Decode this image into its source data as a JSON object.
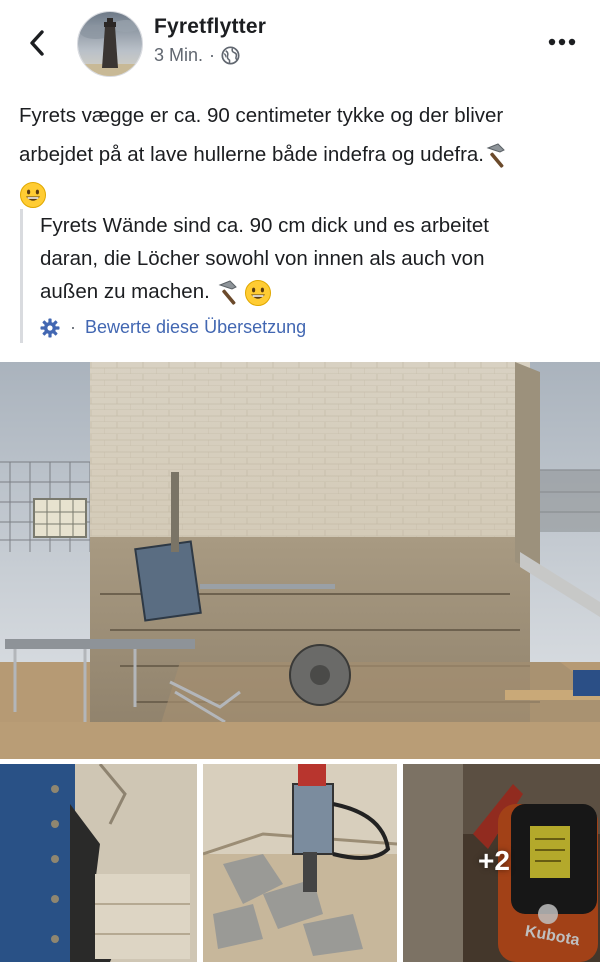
{
  "header": {
    "author_name": "Fyretflytter",
    "time": "3 Min.",
    "meta_separator": "·",
    "audience_icon": "globe-icon",
    "back_icon": "chevron-left-icon",
    "more_icon": "more-dots-icon"
  },
  "post": {
    "line1": "Fyrets vægge er ca. 90 centimeter tykke og der bliver",
    "line2": "arbejdet på at lave hullerne både indefra og udefra.",
    "emojis": [
      "hammer-emoji",
      "grinning-face-emoji"
    ]
  },
  "translation": {
    "line1": "Fyrets Wände sind ca. 90 cm dick und es arbeitet",
    "line2": "daran, die Löcher sowohl von innen als auch von",
    "line3": "außen zu machen.",
    "rate_separator": "·",
    "rate_label": "Bewerte diese Übersetzung",
    "rate_icon": "gear-icon"
  },
  "photos": {
    "main": "lighthouse-wall-construction-photo",
    "thumbs": [
      "blue-panel-wall-photo",
      "demolition-hammer-photo",
      "kubota-excavator-photo"
    ],
    "more_count": "+2",
    "excavator_brand": "Kubota"
  },
  "colors": {
    "link": "#4267b2",
    "meta": "#616770",
    "text": "#1c1e21"
  }
}
